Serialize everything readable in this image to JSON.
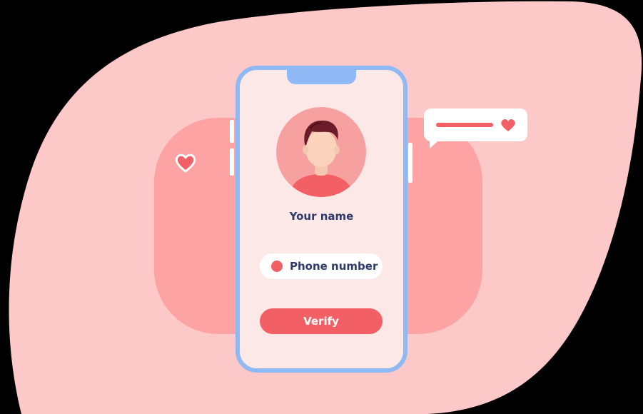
{
  "profile": {
    "name_placeholder": "Your name"
  },
  "phone_input": {
    "placeholder": "Phone number",
    "indicator": "red-dot-icon"
  },
  "actions": {
    "verify_label": "Verify"
  },
  "chat_bubble": {
    "icon": "heart-icon"
  },
  "colors": {
    "background_blob": "#fdc8c8",
    "back_card": "#fda3a3",
    "phone_frame": "#8fb9f5",
    "phone_screen": "#fde8e8",
    "accent": "#f26066",
    "text_dark": "#2d3a6b"
  }
}
